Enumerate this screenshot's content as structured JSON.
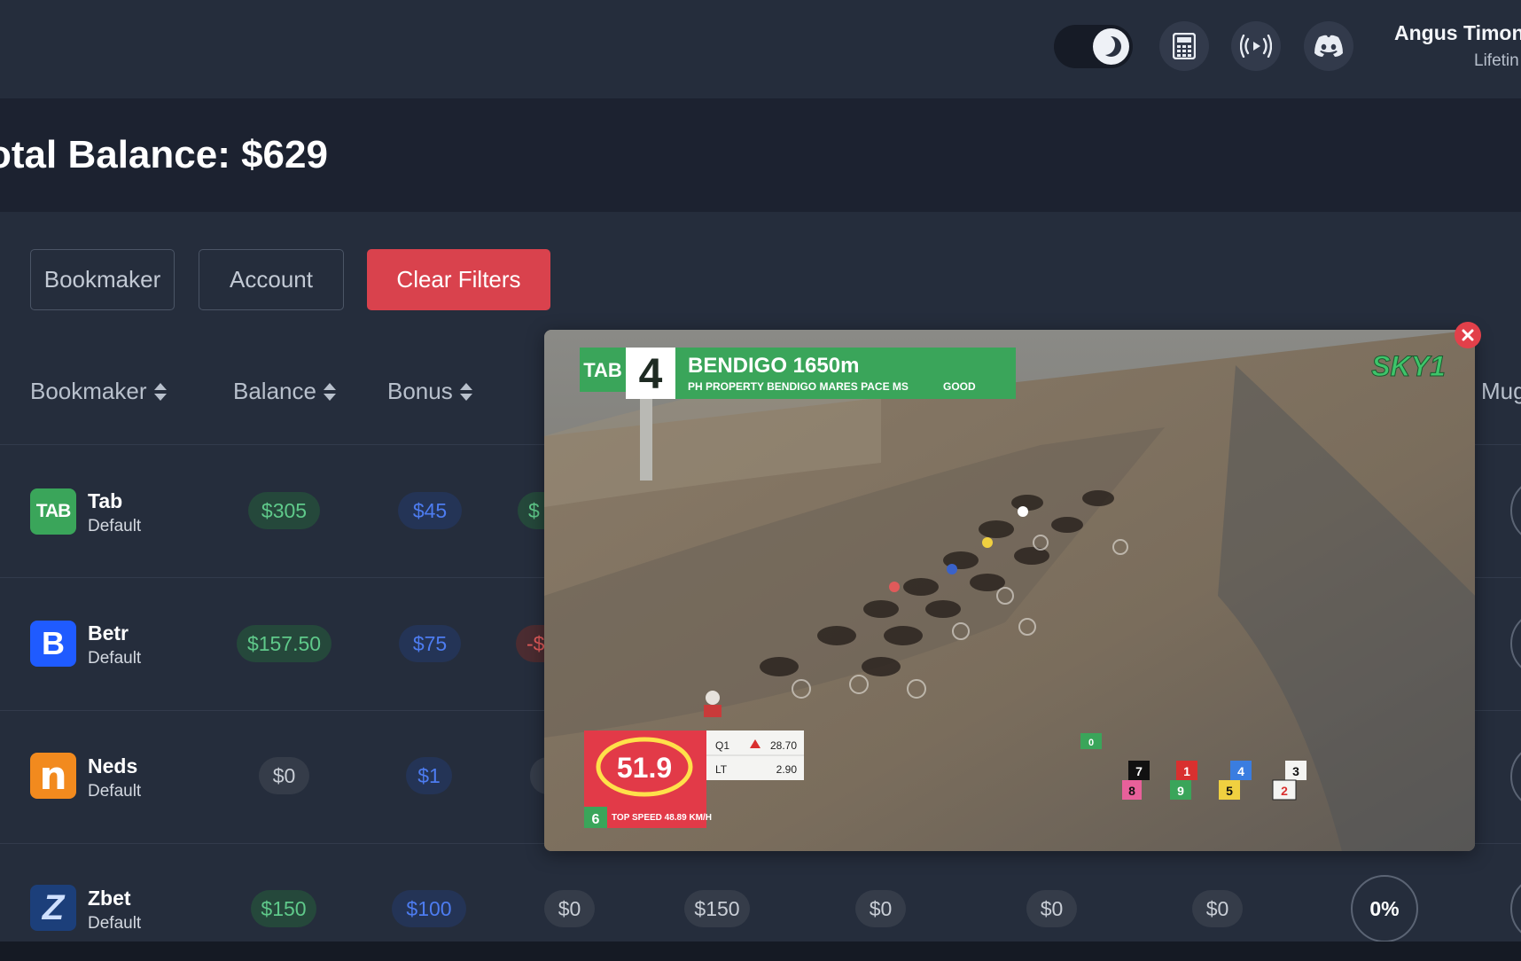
{
  "header": {
    "user_name": "Angus Timone",
    "user_sub": "Lifetin",
    "icons": [
      "moon-icon",
      "calculator-icon",
      "broadcast-icon",
      "discord-icon"
    ]
  },
  "summary": {
    "total_balance": "otal Balance: $629"
  },
  "filters": {
    "bookmaker": "Bookmaker",
    "account": "Account",
    "clear": "Clear Filters"
  },
  "table": {
    "headers": {
      "bookmaker": "Bookmaker",
      "balance": "Balance",
      "bonus": "Bonus",
      "mug": "Mug"
    },
    "rows": [
      {
        "name": "Tab",
        "account": "Default",
        "logo_text": "TAB",
        "balance": "$305",
        "bonus": "$45",
        "partial": "$"
      },
      {
        "name": "Betr",
        "account": "Default",
        "logo_text": "B",
        "balance": "$157.50",
        "bonus": "$75",
        "partial": "-$"
      },
      {
        "name": "Neds",
        "account": "Default",
        "logo_text": "n",
        "balance": "$0",
        "bonus": "$1",
        "partial": ""
      },
      {
        "name": "Zbet",
        "account": "Default",
        "logo_text": "Z",
        "balance": "$150",
        "bonus": "$100",
        "c3": "$0",
        "c4": "$150",
        "c5": "$0",
        "c6": "$0",
        "c7": "$0",
        "pct": "0%"
      }
    ]
  },
  "video": {
    "brand": "TAB",
    "race_number": "4",
    "race_title": "BENDIGO  1650m",
    "race_sub": "PH PROPERTY BENDIGO MARES PACE MS",
    "track_condition": "GOOD",
    "channel": "SKY1",
    "speed": "51.9",
    "top_speed_runner": "6",
    "top_speed_label": "TOP SPEED 48.89 KM/H",
    "q1_label": "Q1",
    "q1_value": "28.70",
    "lt_label": "LT",
    "lt_value": "2.90",
    "runner_tag": "0",
    "runner_order": [
      "7",
      "8",
      "1",
      "9",
      "4",
      "5",
      "3",
      "2"
    ]
  },
  "colors": {
    "accent_red": "#d9424d",
    "green_pill": "#5fc98a",
    "blue_pill": "#4d7cf0",
    "tab_green": "#3aa55a",
    "betr_blue": "#1f5bff",
    "neds_orange": "#f28a1e"
  }
}
